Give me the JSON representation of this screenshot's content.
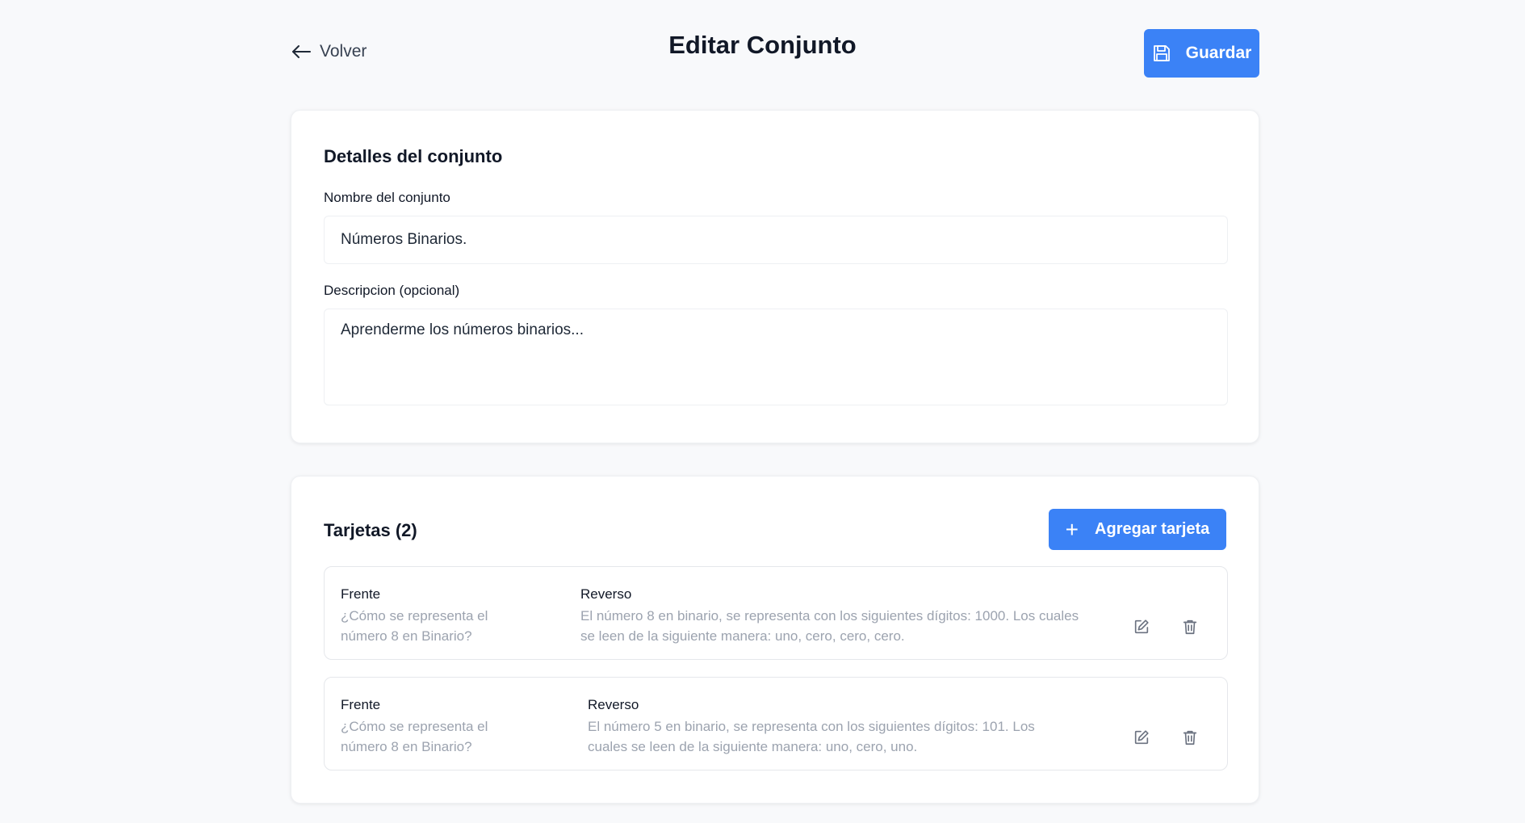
{
  "header": {
    "back_label": "Volver",
    "title": "Editar Conjunto",
    "save_label": "Guardar"
  },
  "details": {
    "section_title": "Detalles del conjunto",
    "name_label": "Nombre del conjunto",
    "name_value": "Números Binarios.",
    "description_label": "Descripcion (opcional)",
    "description_value": "Aprenderme los números binarios..."
  },
  "cards_section": {
    "title": "Tarjetas (2)",
    "add_label": "Agregar tarjeta",
    "cards": [
      {
        "front_label": "Frente",
        "front_text": "¿Cómo se representa el número 8 en Binario?",
        "back_label": "Reverso",
        "back_text": "El número 8 en binario, se representa con los siguientes dígitos: 1000. Los cuales se leen de la siguiente manera: uno, cero, cero, cero."
      },
      {
        "front_label": "Frente",
        "front_text": "¿Cómo se representa el número 8 en Binario?",
        "back_label": "Reverso",
        "back_text": "El número 5 en binario, se representa con los siguientes dígitos: 101. Los cuales se leen de la siguiente manera: uno, cero, uno."
      }
    ]
  },
  "icons": {
    "back": "arrow-left-icon",
    "save": "floppy-disk-icon",
    "add": "plus-icon",
    "edit": "pencil-square-icon",
    "delete": "trash-icon"
  },
  "colors": {
    "primary": "#3b82f6",
    "background": "#f8f9fb",
    "muted_text": "#9ca3af"
  }
}
